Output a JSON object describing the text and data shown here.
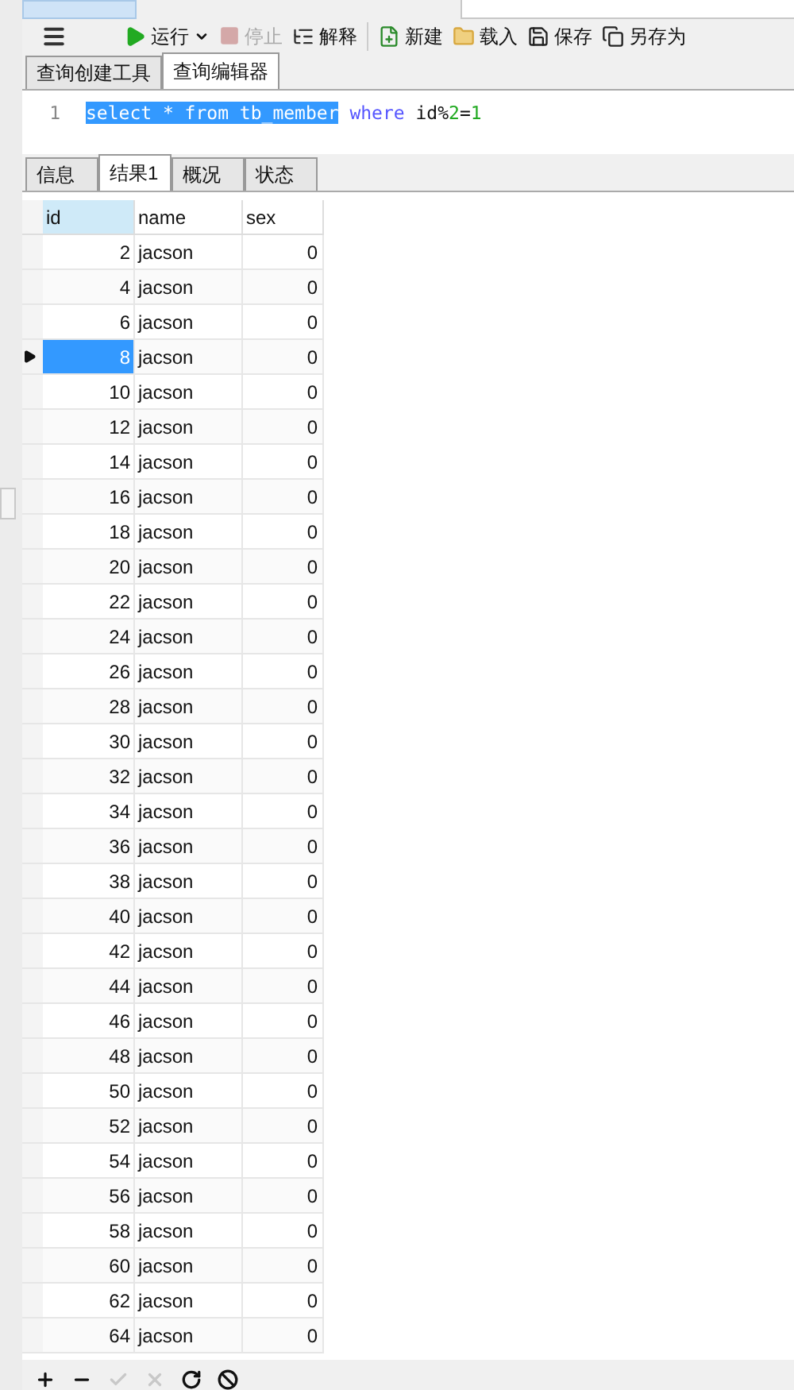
{
  "toolbar": {
    "buttons": [
      {
        "kind": "run",
        "label": "运行",
        "disabled": false
      },
      {
        "kind": "stop",
        "label": "停止",
        "disabled": true
      },
      {
        "kind": "explain",
        "label": "解释",
        "disabled": false
      },
      {
        "kind": "new",
        "label": "新建",
        "disabled": false
      },
      {
        "kind": "load",
        "label": "载入",
        "disabled": false
      },
      {
        "kind": "save",
        "label": "保存",
        "disabled": false
      },
      {
        "kind": "saveas",
        "label": "另存为",
        "disabled": false
      }
    ]
  },
  "editor_tabs": [
    {
      "label": "查询创建工具",
      "selected": false
    },
    {
      "label": "查询编辑器",
      "selected": true
    }
  ],
  "editor": {
    "line_number": "1",
    "selected_code": "select * from tb_member",
    "keyword": "where",
    "code_rest": "id%",
    "number_1": "2",
    "operator": "=",
    "number_2": "1"
  },
  "result_tabs": [
    {
      "label": "信息",
      "selected": false
    },
    {
      "label": "结果1",
      "selected": true
    },
    {
      "label": "概况",
      "selected": false
    },
    {
      "label": "状态",
      "selected": false
    }
  ],
  "table": {
    "columns": [
      "id",
      "name",
      "sex"
    ],
    "rows": [
      {
        "id": "2",
        "name": "jacson",
        "sex": "0",
        "selected": false
      },
      {
        "id": "4",
        "name": "jacson",
        "sex": "0",
        "selected": false
      },
      {
        "id": "6",
        "name": "jacson",
        "sex": "0",
        "selected": false
      },
      {
        "id": "8",
        "name": "jacson",
        "sex": "0",
        "selected": true
      },
      {
        "id": "10",
        "name": "jacson",
        "sex": "0",
        "selected": false
      },
      {
        "id": "12",
        "name": "jacson",
        "sex": "0",
        "selected": false
      },
      {
        "id": "14",
        "name": "jacson",
        "sex": "0",
        "selected": false
      },
      {
        "id": "16",
        "name": "jacson",
        "sex": "0",
        "selected": false
      },
      {
        "id": "18",
        "name": "jacson",
        "sex": "0",
        "selected": false
      },
      {
        "id": "20",
        "name": "jacson",
        "sex": "0",
        "selected": false
      },
      {
        "id": "22",
        "name": "jacson",
        "sex": "0",
        "selected": false
      },
      {
        "id": "24",
        "name": "jacson",
        "sex": "0",
        "selected": false
      },
      {
        "id": "26",
        "name": "jacson",
        "sex": "0",
        "selected": false
      },
      {
        "id": "28",
        "name": "jacson",
        "sex": "0",
        "selected": false
      },
      {
        "id": "30",
        "name": "jacson",
        "sex": "0",
        "selected": false
      },
      {
        "id": "32",
        "name": "jacson",
        "sex": "0",
        "selected": false
      },
      {
        "id": "34",
        "name": "jacson",
        "sex": "0",
        "selected": false
      },
      {
        "id": "36",
        "name": "jacson",
        "sex": "0",
        "selected": false
      },
      {
        "id": "38",
        "name": "jacson",
        "sex": "0",
        "selected": false
      },
      {
        "id": "40",
        "name": "jacson",
        "sex": "0",
        "selected": false
      },
      {
        "id": "42",
        "name": "jacson",
        "sex": "0",
        "selected": false
      },
      {
        "id": "44",
        "name": "jacson",
        "sex": "0",
        "selected": false
      },
      {
        "id": "46",
        "name": "jacson",
        "sex": "0",
        "selected": false
      },
      {
        "id": "48",
        "name": "jacson",
        "sex": "0",
        "selected": false
      },
      {
        "id": "50",
        "name": "jacson",
        "sex": "0",
        "selected": false
      },
      {
        "id": "52",
        "name": "jacson",
        "sex": "0",
        "selected": false
      },
      {
        "id": "54",
        "name": "jacson",
        "sex": "0",
        "selected": false
      },
      {
        "id": "56",
        "name": "jacson",
        "sex": "0",
        "selected": false
      },
      {
        "id": "58",
        "name": "jacson",
        "sex": "0",
        "selected": false
      },
      {
        "id": "60",
        "name": "jacson",
        "sex": "0",
        "selected": false
      },
      {
        "id": "62",
        "name": "jacson",
        "sex": "0",
        "selected": false
      },
      {
        "id": "64",
        "name": "jacson",
        "sex": "0",
        "selected": false
      }
    ]
  },
  "grid_toolbar": [
    {
      "kind": "add",
      "disabled": false
    },
    {
      "kind": "remove",
      "disabled": false
    },
    {
      "kind": "apply",
      "disabled": true
    },
    {
      "kind": "cancel",
      "disabled": true
    },
    {
      "kind": "refresh",
      "disabled": false
    },
    {
      "kind": "stop",
      "disabled": false
    }
  ]
}
